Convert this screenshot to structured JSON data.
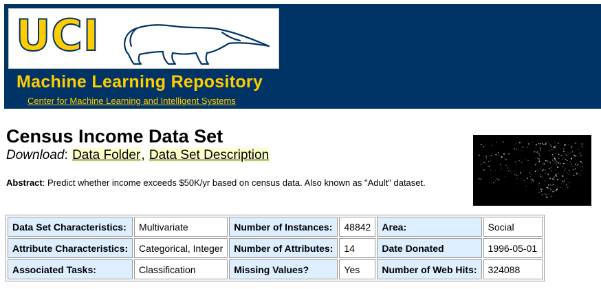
{
  "header": {
    "logo_text": "UCI",
    "repo_title": "Machine Learning Repository",
    "repo_subtitle": "Center for Machine Learning and Intelligent Systems",
    "colors": {
      "banner": "#003366",
      "gold": "#ffcc00"
    }
  },
  "dataset": {
    "title": "Census Income Data Set",
    "download_label": "Download",
    "download_sep": ":",
    "links": [
      "Data Folder",
      "Data Set Description"
    ],
    "link_sep": ",",
    "abstract_label": "Abstract",
    "abstract_text": ": Predict whether income exceeds $50K/yr based on census data. Also known as \"Adult\" dataset.",
    "image_icon": "usa-night-lights-map"
  },
  "table": {
    "rows": [
      [
        {
          "label": "Data Set Characteristics:",
          "value": "Multivariate"
        },
        {
          "label": "Number of Instances:",
          "value": "48842"
        },
        {
          "label": "Area:",
          "value": "Social"
        }
      ],
      [
        {
          "label": "Attribute Characteristics:",
          "value": "Categorical, Integer"
        },
        {
          "label": "Number of Attributes:",
          "value": "14"
        },
        {
          "label": "Date Donated",
          "value": "1996-05-01"
        }
      ],
      [
        {
          "label": "Associated Tasks:",
          "value": "Classification"
        },
        {
          "label": "Missing Values?",
          "value": "Yes"
        },
        {
          "label": "Number of Web Hits:",
          "value": "324088"
        }
      ]
    ]
  }
}
